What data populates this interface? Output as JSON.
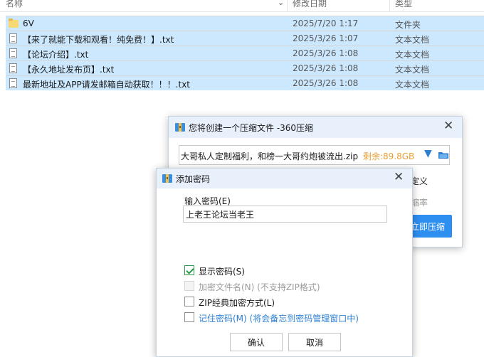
{
  "explorer": {
    "columns": {
      "name": "名称",
      "modified": "修改日期",
      "type": "类型"
    },
    "files": [
      {
        "kind": "folder",
        "name": "6V",
        "modified": "2025/7/20 1:17",
        "type": "文件夹"
      },
      {
        "kind": "text",
        "name": "【来了就能下载和观看！纯免费！】.txt",
        "modified": "2025/3/26 1:07",
        "type": "文本文档"
      },
      {
        "kind": "text",
        "name": "【论坛介绍】.txt",
        "modified": "2025/3/26 1:08",
        "type": "文本文档"
      },
      {
        "kind": "text",
        "name": "【永久地址发布页】.txt",
        "modified": "2025/3/26 1:08",
        "type": "文本文档"
      },
      {
        "kind": "text",
        "name": "最新地址及APP请发邮箱自动获取！！！.txt",
        "modified": "2025/3/26 1:08",
        "type": "文本文档"
      }
    ]
  },
  "compress_dialog": {
    "title": "您将创建一个压缩文件 -360压缩",
    "path": "大哥私人定制福利，和榜一大哥约炮被流出.zip",
    "remaining": "剩余:89.8GB",
    "custom_label": "定义",
    "ratio_label": "缩率",
    "compress_button": "立即压缩"
  },
  "password_dialog": {
    "title": "添加密码",
    "input_label": "输入密码(E)",
    "password_value": "上老王论坛当老王",
    "options": [
      {
        "label": "显示密码(S)",
        "checked": true,
        "disabled": false,
        "link": false
      },
      {
        "label": "加密文件名(N) (不支持ZIP格式)",
        "checked": false,
        "disabled": true,
        "link": false
      },
      {
        "label": "ZIP经典加密方式(L)",
        "checked": false,
        "disabled": false,
        "link": false
      },
      {
        "label": "记住密码(M) (将会备忘到密码管理窗口中)",
        "checked": false,
        "disabled": false,
        "link": true
      }
    ],
    "ok_button": "确认",
    "cancel_button": "取消"
  },
  "colors": {
    "selection": "#cce8ff",
    "titlebar": "#e7f0fb",
    "accent_blue": "#2d8ff0",
    "remaining_orange": "#e8a034",
    "checkbox_green": "#2a9d4a"
  },
  "icons": {
    "folder": "folder-icon",
    "text_file": "text-file-icon",
    "app": "360-zip-icon",
    "close": "close-icon",
    "dropdown": "dropdown-arrow-icon",
    "browse": "browse-folder-icon"
  }
}
